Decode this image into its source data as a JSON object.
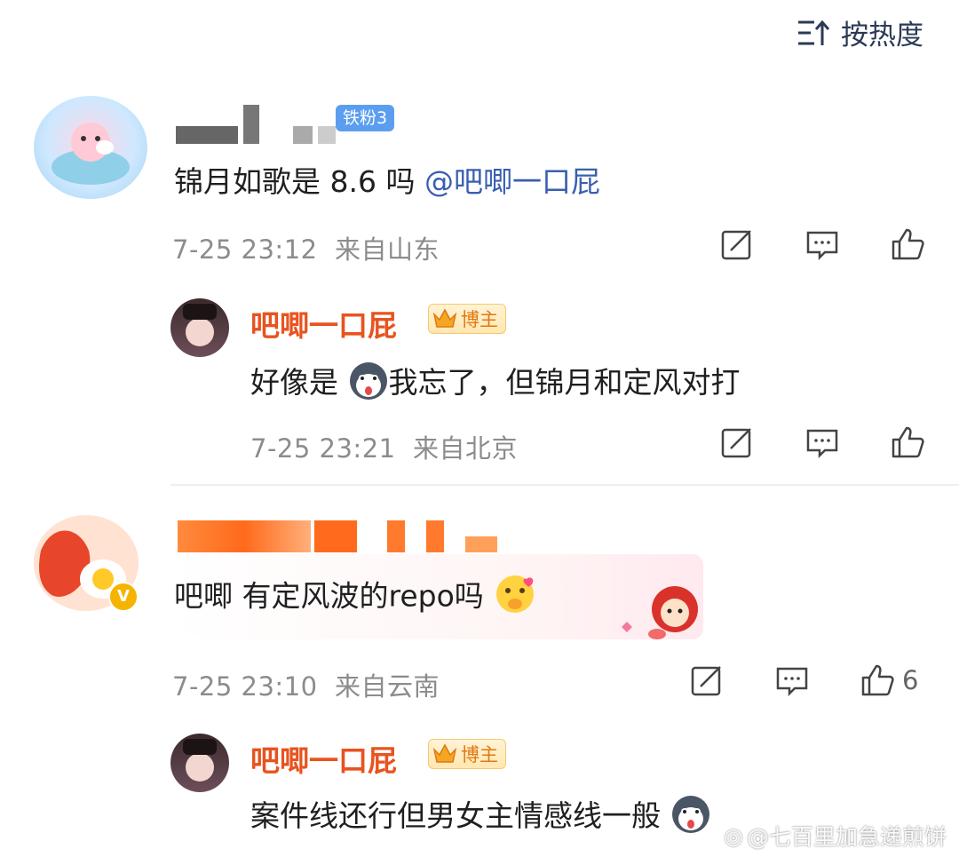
{
  "sort": {
    "label": "按热度",
    "icon": "sort-icon"
  },
  "comments": [
    {
      "fan_badge": "铁粉3",
      "text": "锦月如歌是 8.6 吗 ",
      "mention": "@吧唧一口屁",
      "time": "7-25 23:12",
      "location": "来自山东",
      "likes": ""
    },
    {
      "text_before": "吧唧 有定风波的repo吗",
      "time": "7-25 23:10",
      "location": "来自云南",
      "likes": "6"
    }
  ],
  "replies": [
    {
      "author": "吧唧一口屁",
      "host_badge": "博主",
      "crown_level": "6",
      "text_a": "好像是",
      "text_b": "我忘了，但锦月和定风对打",
      "time": "7-25 23:21",
      "location": "来自北京"
    },
    {
      "author": "吧唧一口屁",
      "host_badge": "博主",
      "crown_level": "6",
      "text": "案件线还行但男女主情感线一般"
    }
  ],
  "watermark": "@七百里加急递煎饼",
  "colors": {
    "author": "#e8531e",
    "mention": "#3a5fb0",
    "meta": "#8c8c8c",
    "fan_badge": "#5b9ef0"
  }
}
